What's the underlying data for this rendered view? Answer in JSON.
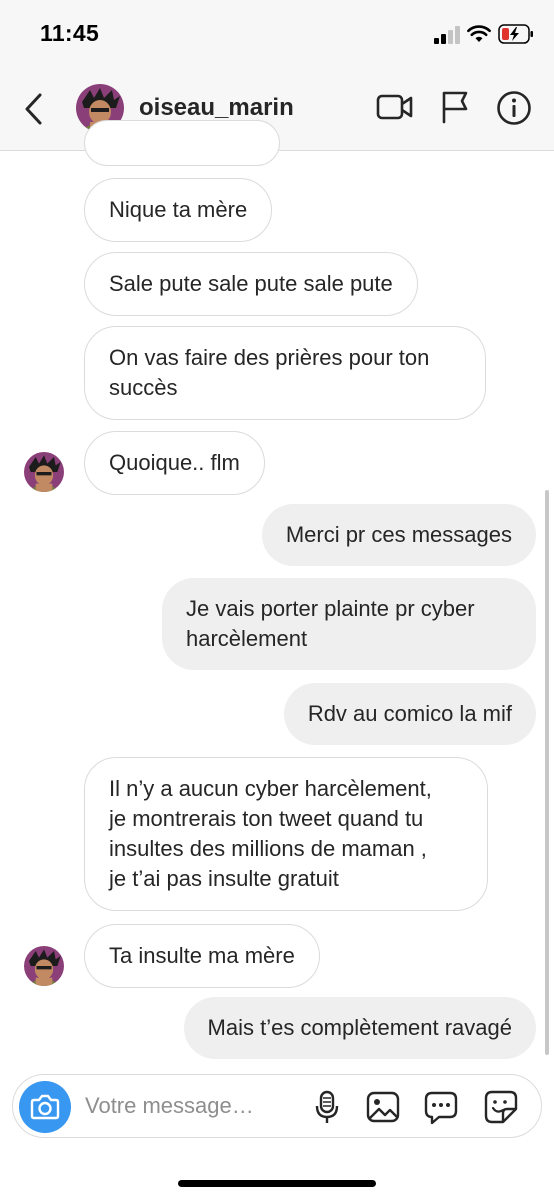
{
  "status_bar": {
    "time": "11:45"
  },
  "header": {
    "username": "oiseau_marin"
  },
  "messages": [
    {
      "text": "Nique ta mère",
      "direction": "incoming"
    },
    {
      "text": "Sale pute sale pute sale pute",
      "direction": "incoming"
    },
    {
      "text": "On vas faire des prières pour ton\nsuccès",
      "direction": "incoming"
    },
    {
      "text": "Quoique.. flm",
      "direction": "incoming"
    },
    {
      "text": "Merci pr ces messages",
      "direction": "outgoing"
    },
    {
      "text": "Je vais porter plainte pr cyber\nharcèlement",
      "direction": "outgoing"
    },
    {
      "text": "Rdv au comico la mif",
      "direction": "outgoing"
    },
    {
      "text": "Il n’y a aucun cyber harcèlement,\nje montrerais ton tweet quand tu\ninsultes des millions de maman ,\nje t’ai pas insulte gratuit",
      "direction": "incoming"
    },
    {
      "text": "Ta insulte ma mère",
      "direction": "incoming"
    },
    {
      "text": "Mais t’es complètement ravagé",
      "direction": "outgoing"
    }
  ],
  "composer": {
    "placeholder": "Votre message…"
  },
  "colors": {
    "accent": "#3897f0",
    "incoming_border": "#dbdbdb",
    "outgoing_bg": "#efefef"
  }
}
